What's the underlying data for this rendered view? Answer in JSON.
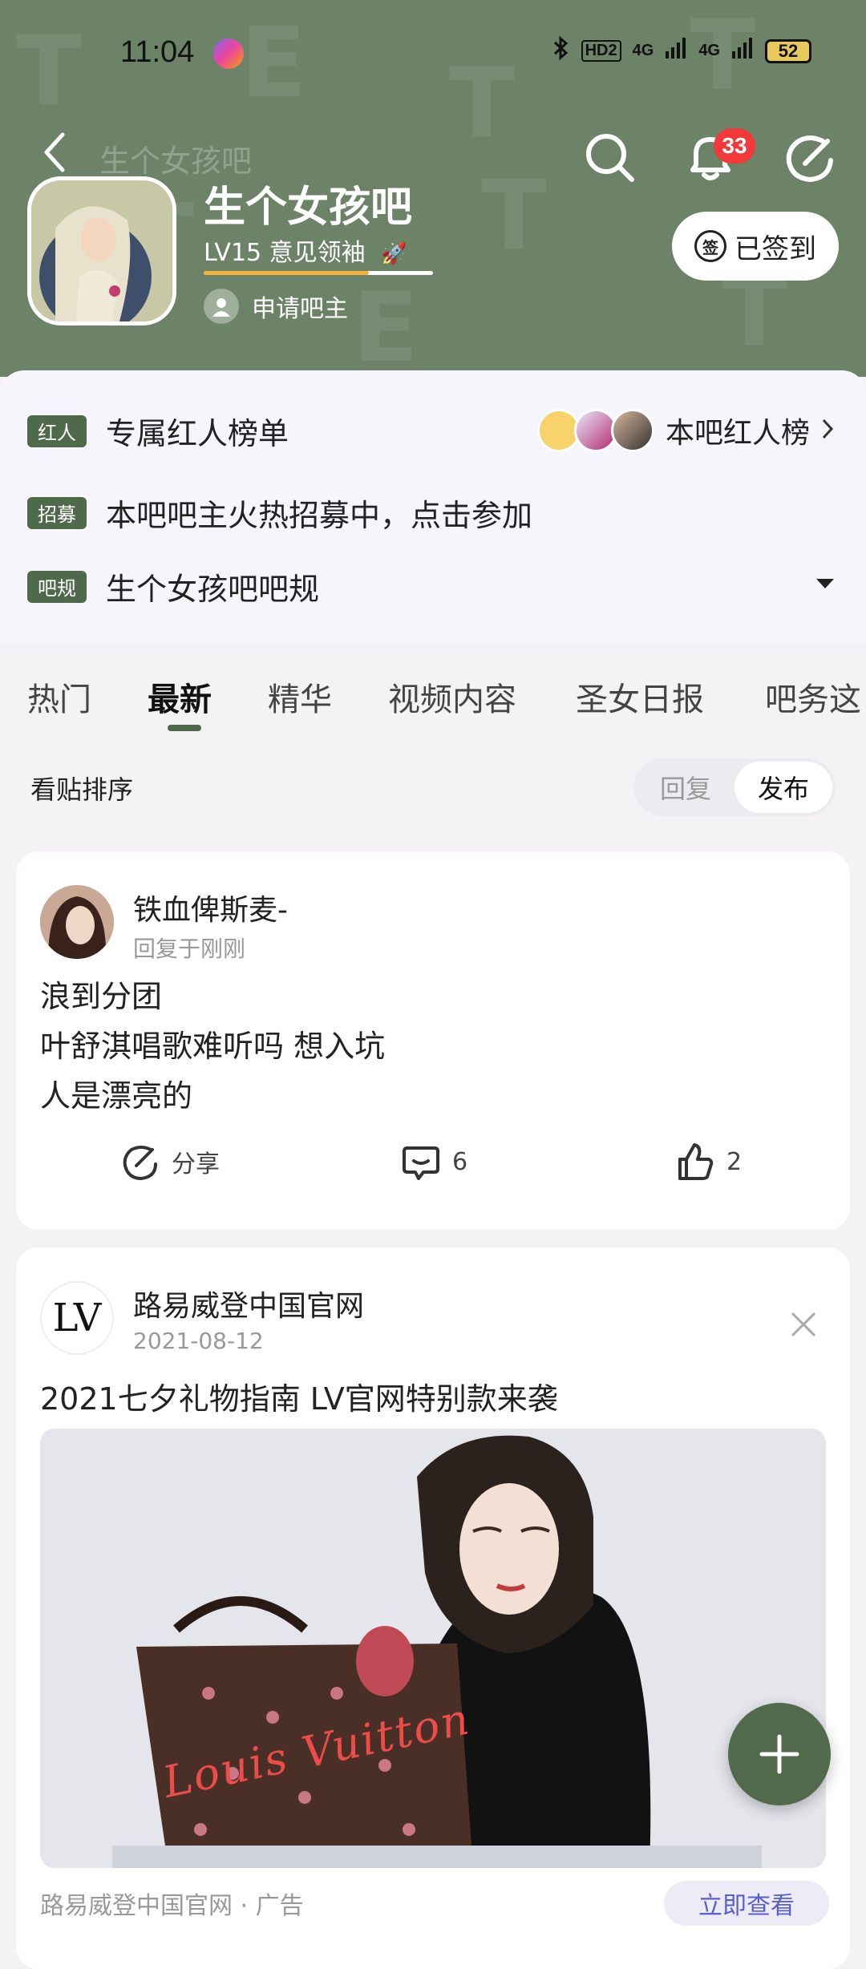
{
  "status": {
    "time": "11:04",
    "battery": "52",
    "net1": "4G",
    "net2": "4G",
    "hd": "HD2"
  },
  "header": {
    "back_title": "生个女孩吧",
    "notification_count": "33"
  },
  "forum": {
    "name": "生个女孩吧",
    "level": "LV15 意见领袖",
    "level_progress": 0.72,
    "apply_label": "申请吧主",
    "signed_label": "已签到",
    "signed_icon_text": "签"
  },
  "info": {
    "rows": [
      {
        "tag": "红人",
        "text": "专属红人榜单"
      },
      {
        "tag": "招募",
        "text": "本吧吧主火热招募中，点击参加"
      },
      {
        "tag": "吧规",
        "text": "生个女孩吧吧规"
      }
    ],
    "rank_label": "本吧红人榜"
  },
  "tabs": [
    "热门",
    "最新",
    "精华",
    "视频内容",
    "圣女日报",
    "吧务这"
  ],
  "active_tab": "最新",
  "sort": {
    "label": "看贴排序",
    "options": [
      "回复",
      "发布"
    ],
    "selected": "发布"
  },
  "post": {
    "author": "铁血俾斯麦-",
    "time": "回复于刚刚",
    "lines": [
      "浪到分团",
      "叶舒淇唱歌难听吗 想入坑",
      "人是漂亮的"
    ],
    "share_label": "分享",
    "comment_count": "6",
    "like_count": "2"
  },
  "ad": {
    "author": "路易威登中国官网",
    "date": "2021-08-12",
    "title": "2021七夕礼物指南 LV官网特别款来袭",
    "logo_text": "LV",
    "bag_text": "Louis Vuitton",
    "footer": "路易威登中国官网 · 广告",
    "cta": "立即查看"
  },
  "colors": {
    "accent": "#4f6a4a",
    "header_bg": "#6d8368",
    "badge": "#f23a3a",
    "fab": "#516a4c"
  }
}
